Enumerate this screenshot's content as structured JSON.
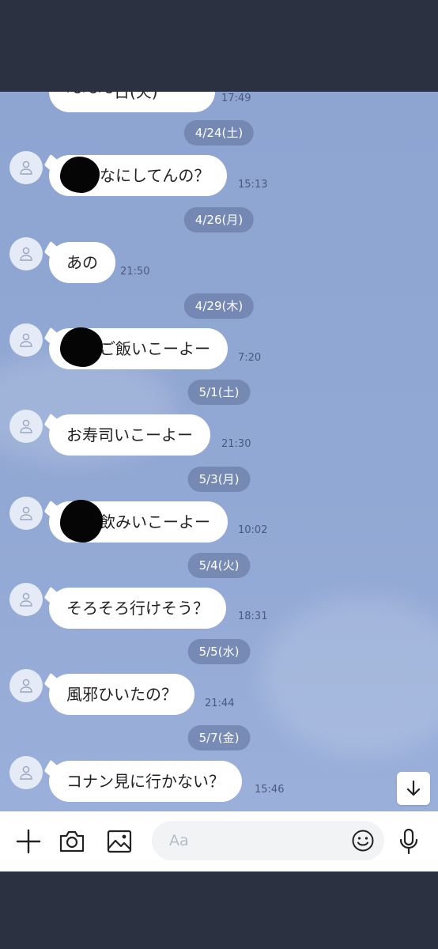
{
  "partial_message": {
    "text": "〜〜〜日(火)",
    "time": "17:49"
  },
  "messages": [
    {
      "date": "4/24(土)",
      "text": "なにしてんの？",
      "time": "15:13"
    },
    {
      "date": "4/26(月)",
      "text": "あの",
      "time": "21:50"
    },
    {
      "date": "4/29(木)",
      "text": "ご飯いこーよー",
      "time": "7:20"
    },
    {
      "date": "5/1(土)",
      "text": "お寿司いこーよー",
      "time": "21:30"
    },
    {
      "date": "5/3(月)",
      "text": "飲みいこーよー",
      "time": "10:02"
    },
    {
      "date": "5/4(火)",
      "text": "そろそろ行けそう？",
      "time": "18:31"
    },
    {
      "date": "5/5(水)",
      "text": "風邪ひいたの？",
      "time": "21:44"
    },
    {
      "date": "5/7(金)",
      "text": "コナン見に行かない？",
      "time": "15:46"
    }
  ],
  "input": {
    "placeholder": "Aa"
  },
  "icons": {
    "add": "plus-icon",
    "camera": "camera-icon",
    "image": "image-icon",
    "emoji": "emoji-icon",
    "mic": "microphone-icon",
    "scroll": "arrow-down-icon",
    "avatar": "user-icon"
  },
  "colors": {
    "chat_bg": "#8ea4d1",
    "bubble": "#ffffff",
    "date_pill": "#6a7ca5",
    "frame": "#2b3140"
  }
}
